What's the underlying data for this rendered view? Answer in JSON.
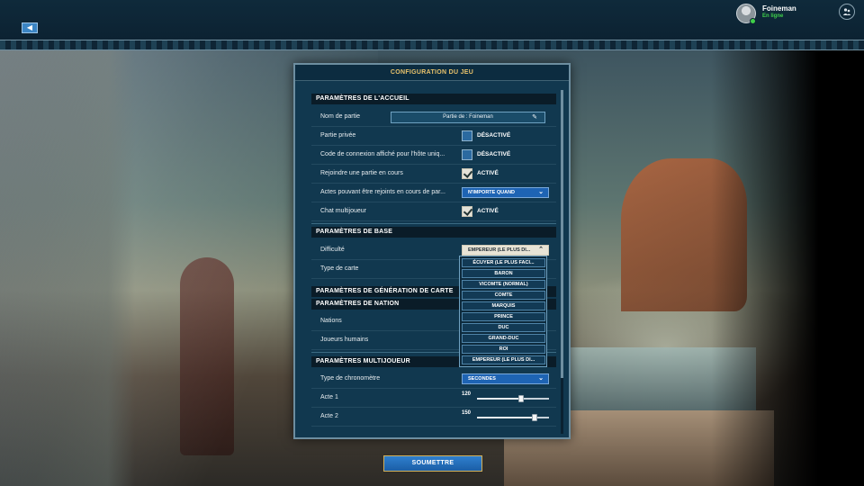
{
  "user": {
    "name": "Foineman",
    "status": "En ligne"
  },
  "dialog": {
    "title": "CONFIGURATION DU JEU",
    "sections": {
      "lobby": "PARAMÈTRES DE L'ACCUEIL",
      "base": "PARAMÈTRES DE BASE",
      "map_gen": "PARAMÈTRES DE GÉNÉRATION DE CARTE",
      "nation": "PARAMÈTRES DE NATION",
      "multiplayer": "PARAMÈTRES MULTIJOUEUR"
    },
    "lobby": {
      "game_name_label": "Nom de partie",
      "game_name_value": "Partie de : Foineman",
      "private_label": "Partie privée",
      "private_value": "DÉSACTIVÉ",
      "code_label": "Code de connexion affiché pour l'hôte uniq...",
      "code_value": "DÉSACTIVÉ",
      "join_label": "Rejoindre une partie en cours",
      "join_value": "ACTIVÉ",
      "acts_label": "Actes pouvant être rejoints en cours de par...",
      "acts_value": "N'IMPORTE QUAND",
      "chat_label": "Chat multijoueur",
      "chat_value": "ACTIVÉ"
    },
    "base": {
      "difficulty_label": "Difficulté",
      "difficulty_value": "EMPEREUR (LE PLUS DI...",
      "map_type_label": "Type de carte"
    },
    "nation": {
      "nations_label": "Nations",
      "humans_label": "Joueurs humains"
    },
    "multiplayer": {
      "timer_label": "Type de chronomètre",
      "timer_value": "SECONDES",
      "act1_label": "Acte 1",
      "act1_value": 120,
      "act2_label": "Acte 2",
      "act2_value": 150
    },
    "difficulty_options": [
      "ÉCUYER (LE PLUS FACI...",
      "BARON",
      "VICOMTE (NORMAL)",
      "COMTE",
      "MARQUIS",
      "PRINCE",
      "DUC",
      "GRAND-DUC",
      "ROI",
      "EMPEREUR (LE PLUS DI..."
    ]
  },
  "submit_label": "SOUMETTRE",
  "colors": {
    "accent": "#1e64b4",
    "title_gold": "#e8c26b",
    "online": "#3fcf4a"
  },
  "icons": {
    "back": "arrow-left-icon",
    "social": "people-icon",
    "edit": "pencil-icon",
    "chevron": "chevron-down-icon"
  }
}
